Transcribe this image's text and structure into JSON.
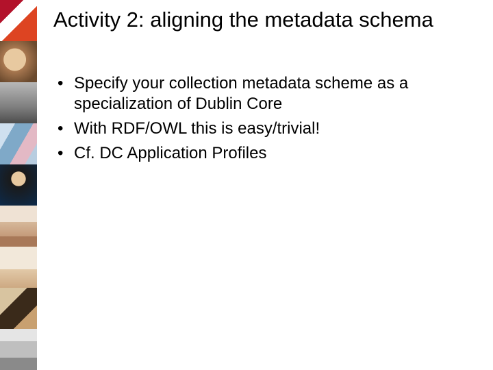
{
  "slide": {
    "title": "Activity 2: aligning the metadata schema",
    "bullets": [
      "Specify your collection metadata scheme as a specialization of Dublin Core",
      "With RDF/OWL this is easy/trivial!",
      "Cf. DC Application Profiles"
    ]
  }
}
